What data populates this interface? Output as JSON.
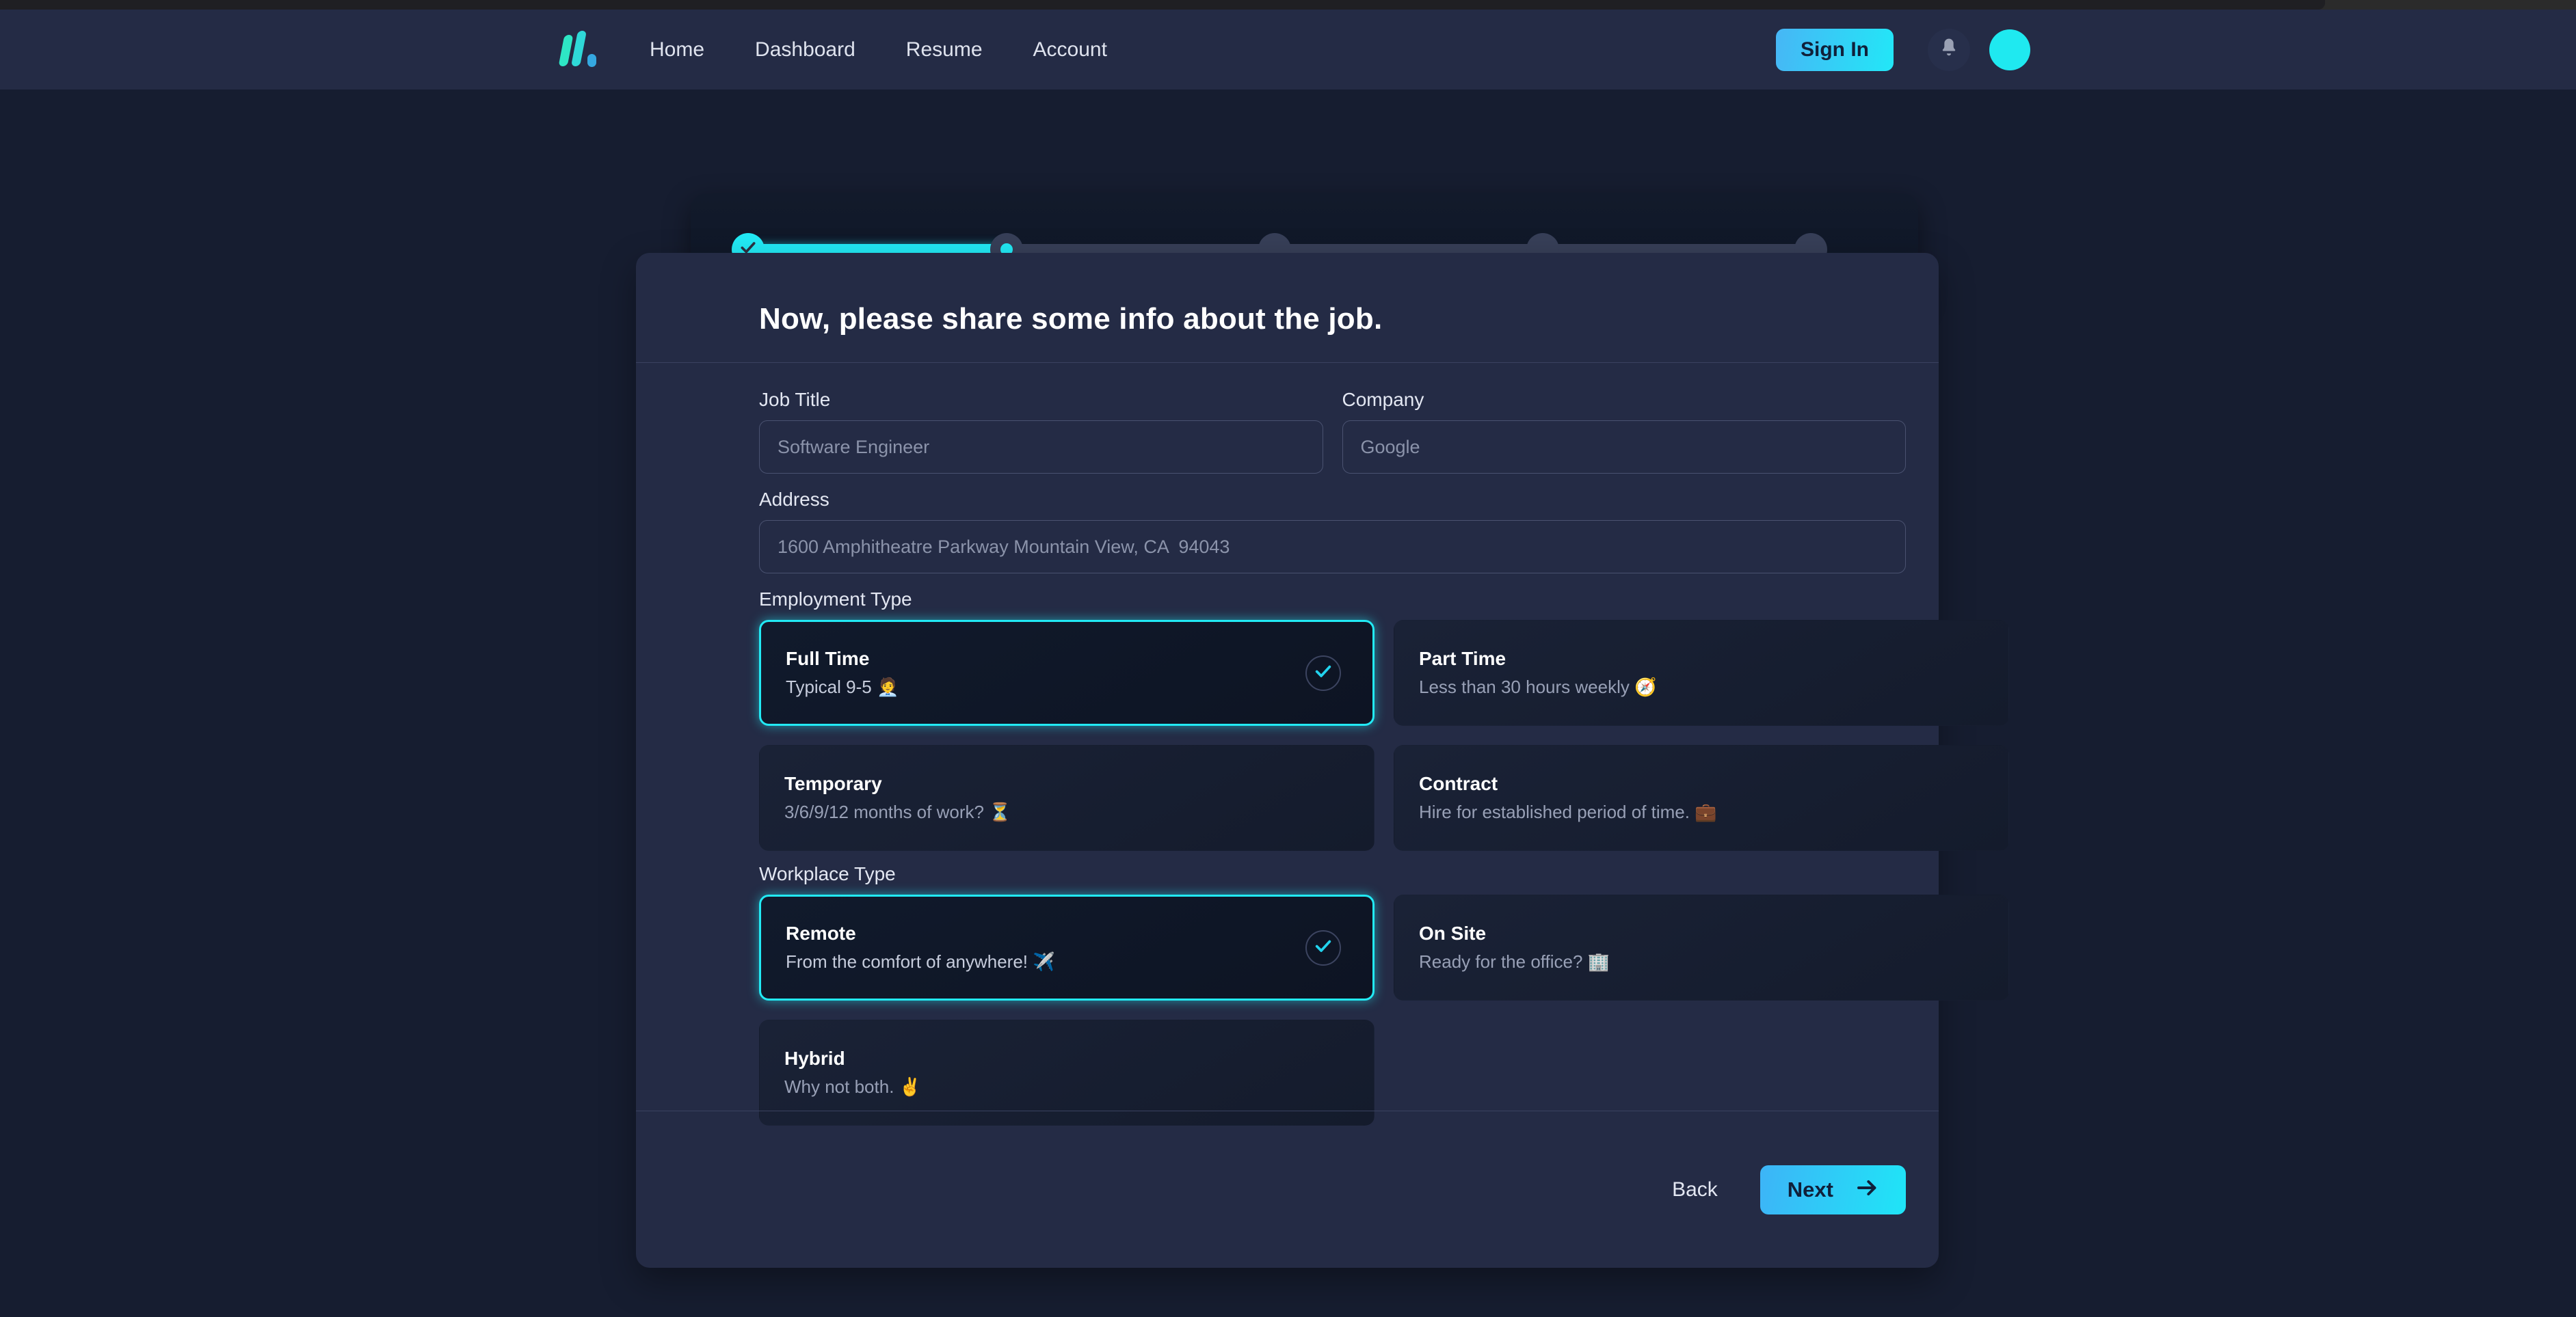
{
  "navbar": {
    "logo_name": "logo-icon",
    "links": [
      {
        "label": "Home"
      },
      {
        "label": "Dashboard"
      },
      {
        "label": "Resume"
      },
      {
        "label": "Account"
      }
    ],
    "sign_in_label": "Sign In",
    "notification_icon": "bell-icon",
    "avatar_label": ""
  },
  "stepper": {
    "total_steps": 5,
    "current_step": 2,
    "steps": [
      {
        "state": "done"
      },
      {
        "state": "current"
      },
      {
        "state": "todo"
      },
      {
        "state": "todo"
      },
      {
        "state": "todo"
      }
    ]
  },
  "page": {
    "title": "Now, please share some info about the job."
  },
  "form": {
    "job_title": {
      "label": "Job Title",
      "value": "",
      "placeholder": "Software Engineer"
    },
    "company": {
      "label": "Company",
      "value": "",
      "placeholder": "Google"
    },
    "address": {
      "label": "Address",
      "value": "",
      "placeholder": "1600 Amphitheatre Parkway Mountain View, CA  94043"
    }
  },
  "employment_type": {
    "label": "Employment Type",
    "options": [
      {
        "title": "Full Time",
        "subtitle": "Typical 9-5 🧑‍💼",
        "selected": true
      },
      {
        "title": "Part Time",
        "subtitle": "Less than 30 hours weekly 🧭",
        "selected": false
      },
      {
        "title": "Temporary",
        "subtitle": "3/6/9/12 months of work? ⏳",
        "selected": false
      },
      {
        "title": "Contract",
        "subtitle": "Hire for established period of time. 💼",
        "selected": false
      }
    ]
  },
  "workplace_type": {
    "label": "Workplace Type",
    "options": [
      {
        "title": "Remote",
        "subtitle": "From the comfort of anywhere! ✈️",
        "selected": true
      },
      {
        "title": "On Site",
        "subtitle": "Ready for the office? 🏢",
        "selected": false
      },
      {
        "title": "Hybrid",
        "subtitle": "Why not both. ✌️",
        "selected": false
      }
    ]
  },
  "footer": {
    "back_label": "Back",
    "next_label": "Next",
    "next_icon": "arrow-right-icon"
  },
  "colors": {
    "accent": "#22eaf5",
    "page_bg": "#161d30",
    "navbar_bg": "#242b45",
    "card_bg": "#242b45",
    "panel_bg": "#121a2b"
  }
}
